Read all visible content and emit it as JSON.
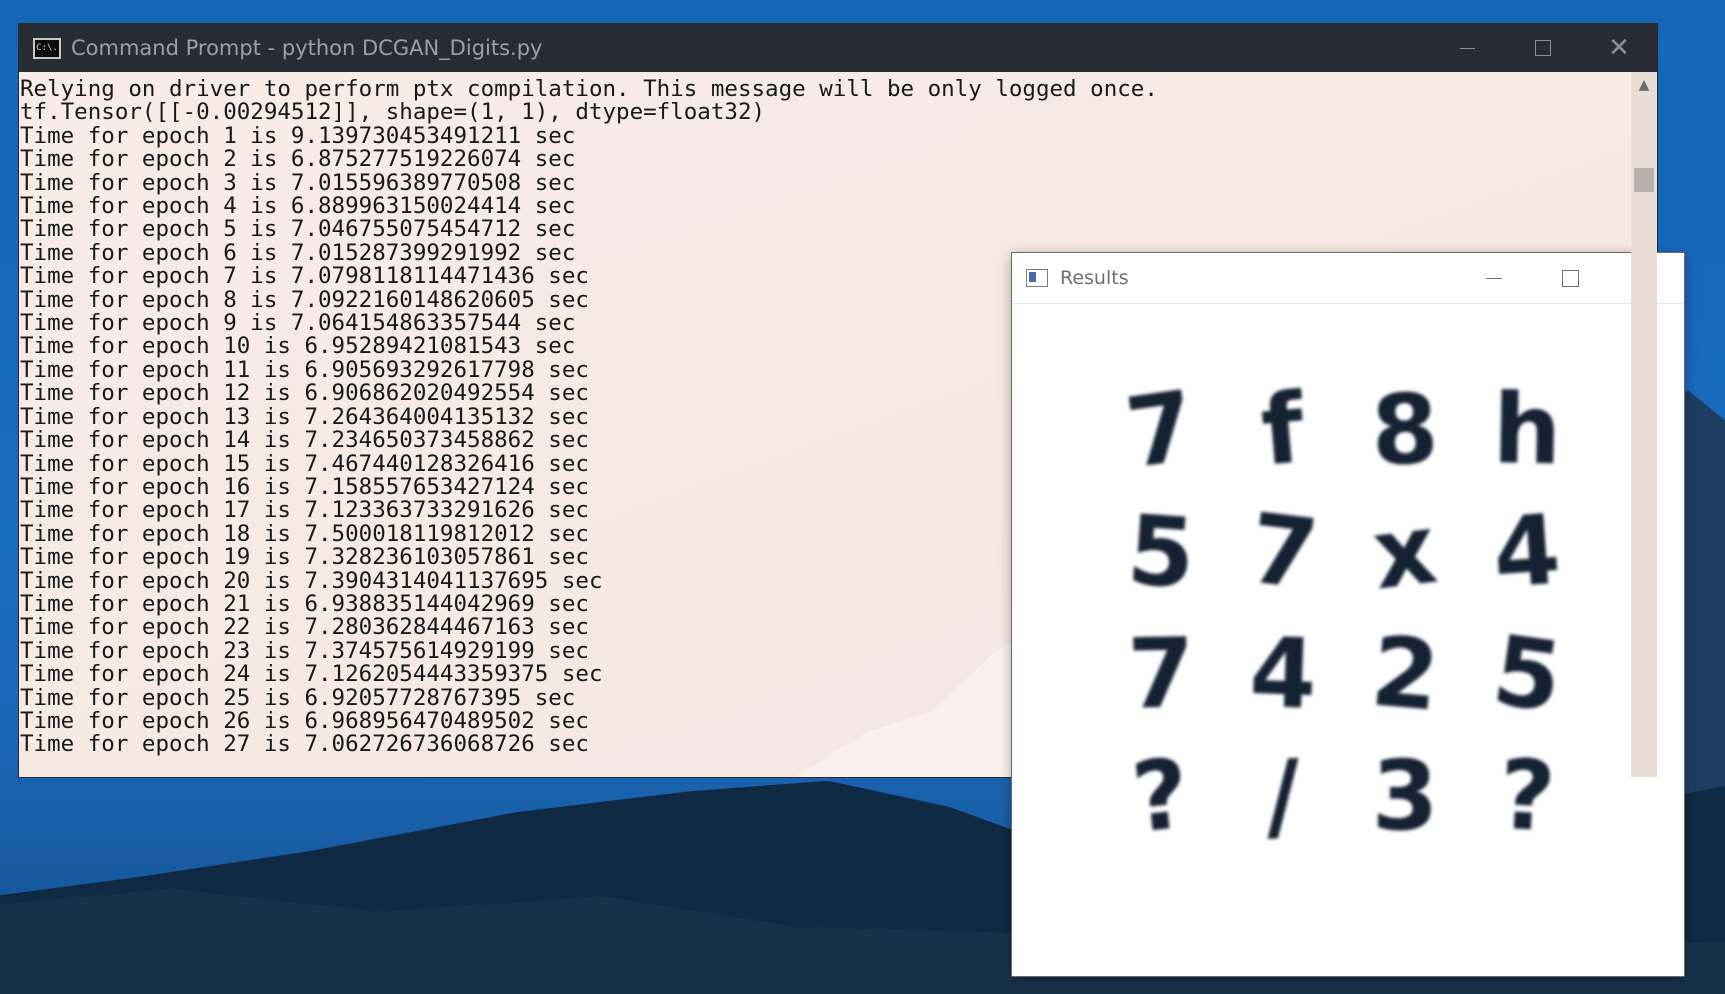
{
  "cmd": {
    "title": "Command Prompt - python  DCGAN_Digits.py",
    "icon": "cmd-icon",
    "icon_text": "C:\\.",
    "lines": [
      "Relying on driver to perform ptx compilation. This message will be only logged once.",
      "tf.Tensor([[-0.00294512]], shape=(1, 1), dtype=float32)",
      "Time for epoch 1 is 9.139730453491211 sec",
      "Time for epoch 2 is 6.875277519226074 sec",
      "Time for epoch 3 is 7.015596389770508 sec",
      "Time for epoch 4 is 6.889963150024414 sec",
      "Time for epoch 5 is 7.046755075454712 sec",
      "Time for epoch 6 is 7.015287399291992 sec",
      "Time for epoch 7 is 7.0798118114471436 sec",
      "Time for epoch 8 is 7.0922160148620605 sec",
      "Time for epoch 9 is 7.064154863357544 sec",
      "Time for epoch 10 is 6.95289421081543 sec",
      "Time for epoch 11 is 6.905693292617798 sec",
      "Time for epoch 12 is 6.906862020492554 sec",
      "Time for epoch 13 is 7.264364004135132 sec",
      "Time for epoch 14 is 7.234650373458862 sec",
      "Time for epoch 15 is 7.467440128326416 sec",
      "Time for epoch 16 is 7.158557653427124 sec",
      "Time for epoch 17 is 7.123363733291626 sec",
      "Time for epoch 18 is 7.500018119812012 sec",
      "Time for epoch 19 is 7.328236103057861 sec",
      "Time for epoch 20 is 7.3904314041137695 sec",
      "Time for epoch 21 is 6.938835144042969 sec",
      "Time for epoch 22 is 7.280362844467163 sec",
      "Time for epoch 23 is 7.374575614929199 sec",
      "Time for epoch 24 is 7.1262054443359375 sec",
      "Time for epoch 25 is 6.92057728767395 sec",
      "Time for epoch 26 is 6.968956470489502 sec",
      "Time for epoch 27 is 7.062726736068726 sec"
    ]
  },
  "results": {
    "title": "Results",
    "icon": "image-window-icon",
    "grid_rows": 4,
    "grid_cols": 4,
    "digit_glyphs": [
      "7",
      "f",
      "8",
      "h",
      "5",
      "7",
      "x",
      "4",
      "7",
      "4",
      "2",
      "5",
      "?",
      "/",
      "3",
      "?"
    ],
    "digit_color": "#142033"
  },
  "controls": {
    "minimize_icon": "minimize-icon",
    "maximize_icon": "maximize-icon",
    "close_icon": "close-icon"
  }
}
